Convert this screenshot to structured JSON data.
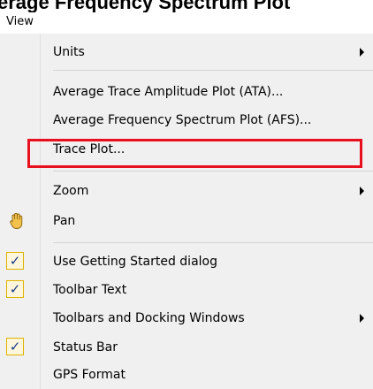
{
  "heading_text": "erage Frequency Spectrum Plot",
  "menubar": {
    "view_label": "View"
  },
  "menu": {
    "units": "Units",
    "ata": "Average Trace Amplitude Plot (ATA)...",
    "afs": "Average Frequency Spectrum Plot (AFS)...",
    "trace_plot": "Trace Plot...",
    "zoom": "Zoom",
    "pan": "Pan",
    "getting_started": "Use Getting Started dialog",
    "toolbar_text": "Toolbar Text",
    "toolbars_docking": "Toolbars and Docking Windows",
    "status_bar": "Status Bar",
    "gps_format": "GPS Format",
    "check_glyph": "✓"
  },
  "icons": {
    "submenu_arrow": "triangle-right",
    "pan": "hand-icon",
    "check": "checkmark-icon"
  },
  "colors": {
    "menu_bg": "#f0f0f0",
    "highlight_border": "#e8101e",
    "check_bg": "#fff6dc",
    "check_border": "#e0b200",
    "check_mark": "#1a3a8a"
  },
  "states": {
    "getting_started_checked": true,
    "toolbar_text_checked": true,
    "status_bar_checked": true,
    "highlighted_item": "afs"
  }
}
